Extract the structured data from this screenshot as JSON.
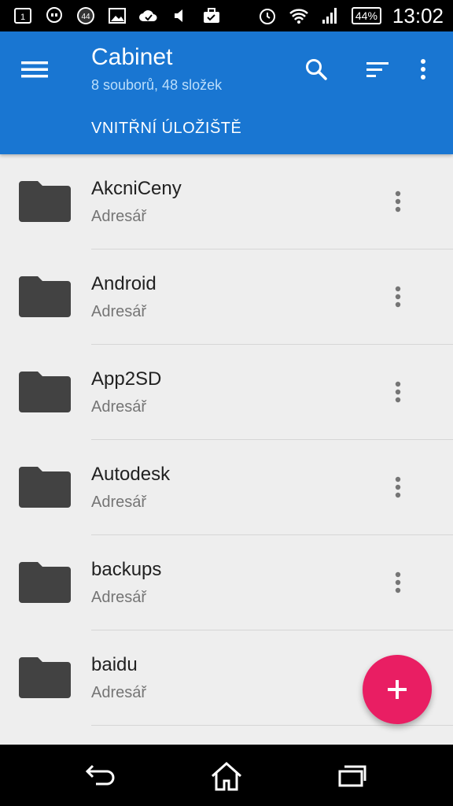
{
  "status_bar": {
    "notification_icons": [
      "sim-1-icon",
      "hangouts-icon",
      "counter-badge-icon",
      "image-icon",
      "cloud-check-icon",
      "volume-icon",
      "briefcase-icon"
    ],
    "badge_count": "44",
    "battery": "44%",
    "time": "13:02"
  },
  "app_bar": {
    "title": "Cabinet",
    "subtitle": "8 souborů, 48 složek",
    "breadcrumb": "VNITŘNÍ ÚLOŽIŠTĚ",
    "color": "#1976d2"
  },
  "files": [
    {
      "name": "AkcniCeny",
      "type": "Adresář"
    },
    {
      "name": "Android",
      "type": "Adresář"
    },
    {
      "name": "App2SD",
      "type": "Adresář"
    },
    {
      "name": "Autodesk",
      "type": "Adresář"
    },
    {
      "name": "backups",
      "type": "Adresář"
    },
    {
      "name": "baidu",
      "type": "Adresář"
    }
  ],
  "fab": {
    "icon": "plus-icon",
    "color": "#e91e63"
  }
}
